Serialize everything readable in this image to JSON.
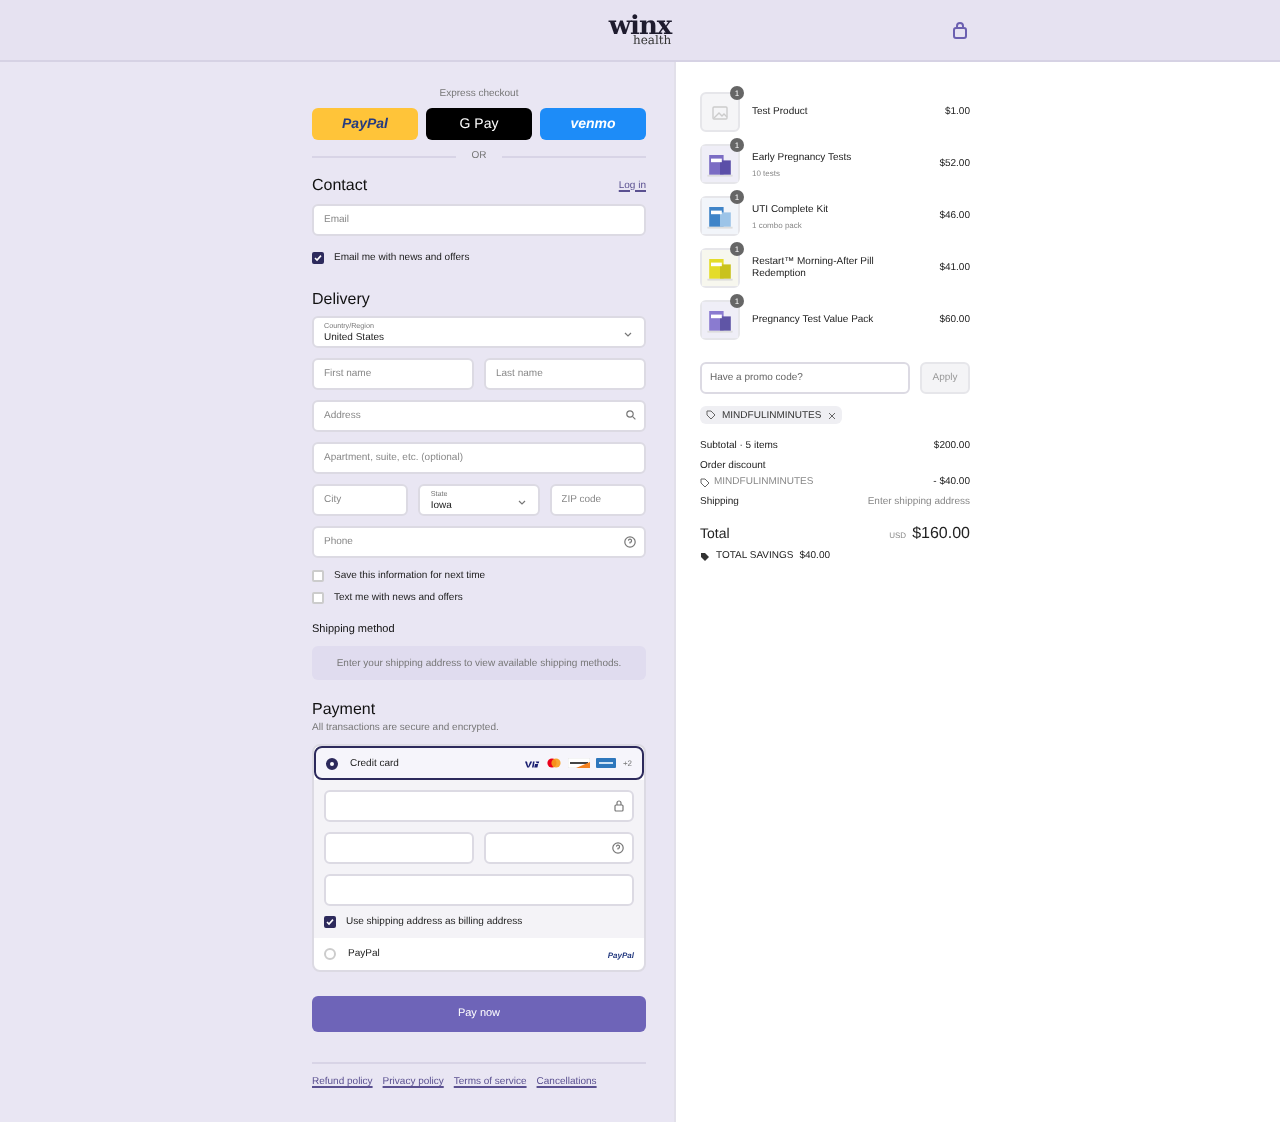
{
  "header": {
    "logo": "winx",
    "logo_sub": "health"
  },
  "express": {
    "title": "Express checkout",
    "buttons": [
      {
        "kind": "paypal",
        "label": "PayPal"
      },
      {
        "kind": "gpay",
        "label": "G Pay"
      },
      {
        "kind": "venmo",
        "label": "venmo"
      }
    ],
    "divider": "OR"
  },
  "contact": {
    "title": "Contact",
    "login": "Log in",
    "email_placeholder": "Email",
    "news": {
      "label": "Email me with news and offers",
      "checked": true
    }
  },
  "delivery": {
    "title": "Delivery",
    "rows": [
      [
        {
          "kind": "select",
          "label": "Country/Region",
          "value": "United States"
        }
      ],
      [
        {
          "kind": "text",
          "placeholder": "First name"
        },
        {
          "kind": "text",
          "placeholder": "Last name"
        }
      ],
      [
        {
          "kind": "search",
          "placeholder": "Address"
        }
      ],
      [
        {
          "kind": "text",
          "placeholder": "Apartment, suite, etc. (optional)"
        }
      ],
      [
        {
          "kind": "text",
          "placeholder": "City"
        },
        {
          "kind": "select",
          "label": "State",
          "value": "Iowa"
        },
        {
          "kind": "text",
          "placeholder": "ZIP code"
        }
      ],
      [
        {
          "kind": "help",
          "placeholder": "Phone"
        }
      ]
    ],
    "options": [
      {
        "label": "Save this information for next time",
        "checked": false
      },
      {
        "label": "Text me with news and offers",
        "checked": false
      }
    ]
  },
  "shipping": {
    "title": "Shipping method",
    "message": "Enter your shipping address to view available shipping methods."
  },
  "payment": {
    "title": "Payment",
    "subtitle": "All transactions are secure and encrypted.",
    "methods": [
      {
        "kind": "card",
        "label": "Credit card",
        "selected": true,
        "more": "+2"
      },
      {
        "kind": "paypal",
        "label": "PayPal",
        "selected": false,
        "badge": "PayPal"
      }
    ],
    "billing": {
      "label": "Use shipping address as billing address",
      "checked": true
    }
  },
  "pay_button": "Pay now",
  "footer_links": [
    "Refund policy",
    "Privacy policy",
    "Terms of service",
    "Cancellations"
  ],
  "summary": {
    "items": [
      {
        "kind": "placeholder",
        "name": "Test Product",
        "price": "$1.00",
        "quantity": "1"
      },
      {
        "kind": "picture",
        "name": "Early Pregnancy Tests",
        "detail": "10 tests",
        "price": "$52.00",
        "quantity": "1"
      },
      {
        "kind": "picture",
        "name": "UTI Complete Kit",
        "detail": "1 combo pack",
        "price": "$46.00",
        "quantity": "1"
      },
      {
        "kind": "picture",
        "name": "Restart™ Morning-After Pill Redemption",
        "price": "$41.00",
        "quantity": "1"
      },
      {
        "kind": "picture",
        "name": "Pregnancy Test Value Pack",
        "price": "$60.00",
        "quantity": "1"
      }
    ],
    "promo": {
      "placeholder": "Have a promo code?",
      "button": "Apply"
    },
    "applied_code": "MINDFULINMINUTES",
    "subtotal": {
      "label": "Subtotal · 5 items",
      "value": "$200.00"
    },
    "discount": {
      "label": "Order discount",
      "code": "MINDFULINMINUTES",
      "value": "- $40.00"
    },
    "shipping": {
      "label": "Shipping",
      "value": "Enter shipping address"
    },
    "total": {
      "label": "Total",
      "currency": "USD",
      "value": "$160.00"
    },
    "savings": {
      "label": "TOTAL SAVINGS",
      "value": "$40.00"
    }
  }
}
